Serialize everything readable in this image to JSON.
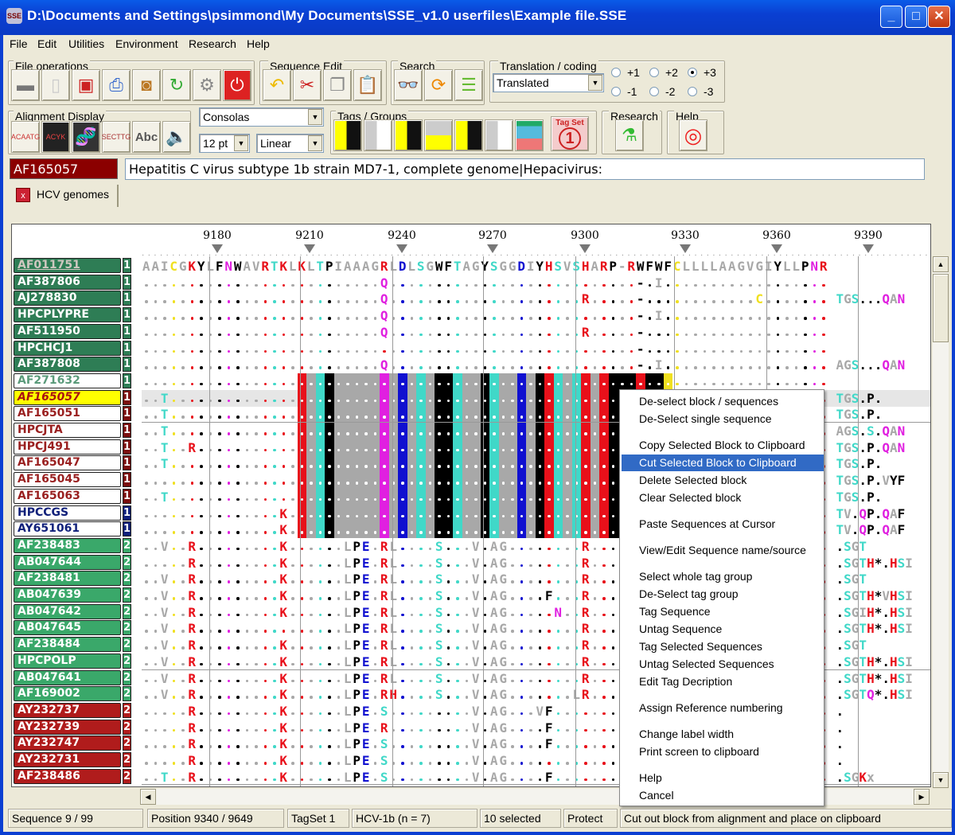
{
  "window": {
    "title": "D:\\Documents and Settings\\psimmond\\My Documents\\SSE_v1.0 userfiles\\Example file.SSE",
    "app_icon": "SSE",
    "controls": {
      "minimize": "_",
      "maximize": "□",
      "close": "✕"
    }
  },
  "menu": [
    "File",
    "Edit",
    "Utilities",
    "Environment",
    "Research",
    "Help"
  ],
  "toolbar": {
    "file_operations": {
      "label": "File operations",
      "buttons": [
        "open-folder",
        "new-document",
        "save",
        "print",
        "export-archive",
        "import",
        "settings-gear",
        "exit-power"
      ]
    },
    "sequence_edit": {
      "label": "Sequence Edit",
      "buttons": [
        "undo",
        "cut",
        "copy",
        "paste"
      ]
    },
    "search": {
      "label": "Search",
      "buttons": [
        "find-binoculars",
        "find-next",
        "search-list"
      ]
    },
    "translation": {
      "label": "Translation / coding",
      "mode": "Translated",
      "frames": [
        {
          "label": "+1",
          "selected": false
        },
        {
          "label": "+2",
          "selected": false
        },
        {
          "label": "+3",
          "selected": true
        },
        {
          "label": "-1",
          "selected": false
        },
        {
          "label": "-2",
          "selected": false
        },
        {
          "label": "-3",
          "selected": false
        }
      ]
    },
    "alignment_display": {
      "label": "Alignment Display",
      "font": "Consolas",
      "size": "12 pt",
      "layout": "Linear",
      "buttons": [
        "nucleotide-view",
        "colour-view",
        "dna-helix",
        "complement-view",
        "text-abc",
        "sound"
      ]
    },
    "tags_groups": {
      "label": "Tags / Groups",
      "buttons": [
        "tag-1",
        "tag-2",
        "tag-3",
        "tag-4",
        "tag-5",
        "tag-6",
        "tag-table"
      ],
      "tag_set_label": "Tag Set",
      "tag_set_number": "1"
    },
    "research": {
      "label": "Research"
    },
    "help": {
      "label": "Help"
    }
  },
  "current_sequence": {
    "accession": "AF165057",
    "description": "Hepatitis C virus subtype 1b strain MD7-1, complete genome|Hepacivirus:"
  },
  "tabs": [
    {
      "label": "HCV genomes",
      "close": "x"
    }
  ],
  "ruler": {
    "ticks": [
      "9180",
      "9210",
      "9240",
      "9270",
      "9300",
      "9330",
      "9360",
      "9390"
    ]
  },
  "colors": {
    "group1_green": "#2e7d55",
    "group2_green": "#3aa86a",
    "group_red": "#b01c1c",
    "group_darkred": "#7a0f0f",
    "group_navy": "#10207a",
    "highlight_yellow": "#ffff00",
    "menu_highlight": "#316ac5",
    "res_red": "#e8101a",
    "res_cyan": "#40d8c8",
    "res_magenta": "#e020e0",
    "res_blue": "#1010d0",
    "res_yellow": "#f0e020",
    "res_gray": "#a8a8a8",
    "res_black": "#000000"
  },
  "consensus": "AAICGKYLFNWAVRTKLKLTPIAAAGRLDLSGWFTAGYSGGDIYHSVSHARP-RWFWFCLLLLAAGVGIYLLPNR*RLG*TLRPL",
  "sequences": [
    {
      "name": "AF011751",
      "group": "1",
      "style": "g1u",
      "right": ""
    },
    {
      "name": "AF387806",
      "group": "1",
      "style": "g1",
      "right": ""
    },
    {
      "name": "AJ278830",
      "group": "1",
      "style": "g1",
      "right": "TGS...QAN"
    },
    {
      "name": "HPCPLYPRE",
      "group": "1",
      "style": "g1",
      "right": ""
    },
    {
      "name": "AF511950",
      "group": "1",
      "style": "g1",
      "right": ""
    },
    {
      "name": "HPCHCJ1",
      "group": "1",
      "style": "g1",
      "right": ""
    },
    {
      "name": "AF387808",
      "group": "1",
      "style": "g1",
      "right": "AGS...QAN"
    },
    {
      "name": "AF271632",
      "group": "1",
      "style": "w-green",
      "right": ""
    },
    {
      "name": "AF165057",
      "group": "1",
      "style": "yellow",
      "right": "TGS.P."
    },
    {
      "name": "AF165051",
      "group": "1",
      "style": "w-red",
      "right": "TGS.P."
    },
    {
      "name": "HPCJTA",
      "group": "1",
      "style": "w-red",
      "right": "AGS.S.QAN"
    },
    {
      "name": "HPCJ491",
      "group": "1",
      "style": "w-red",
      "right": "TGS.P.QAN"
    },
    {
      "name": "AF165047",
      "group": "1",
      "style": "w-red",
      "right": "TGS.P."
    },
    {
      "name": "AF165045",
      "group": "1",
      "style": "w-red",
      "right": "TGS.P.VYF"
    },
    {
      "name": "AF165063",
      "group": "1",
      "style": "w-red",
      "right": "TGS.P."
    },
    {
      "name": "HPCCGS",
      "group": "1",
      "style": "w-navy",
      "right": "TV.QP.QAF"
    },
    {
      "name": "AY651061",
      "group": "1",
      "style": "w-navy",
      "right": "TV.QP.QAF"
    },
    {
      "name": "AF238483",
      "group": "2",
      "style": "g2",
      "right": ".SGT"
    },
    {
      "name": "AB047644",
      "group": "2",
      "style": "g2",
      "right": ".SGTH*.HSI"
    },
    {
      "name": "AF238481",
      "group": "2",
      "style": "g2",
      "right": ".SGT"
    },
    {
      "name": "AB047639",
      "group": "2",
      "style": "g2",
      "right": ".SGTH*VHSI"
    },
    {
      "name": "AB047642",
      "group": "2",
      "style": "g2",
      "right": ".SGIH*.HSI"
    },
    {
      "name": "AB047645",
      "group": "2",
      "style": "g2",
      "right": ".SGTH*.HSI"
    },
    {
      "name": "AF238484",
      "group": "2",
      "style": "g2",
      "right": ".SGT"
    },
    {
      "name": "HPCPOLP",
      "group": "2",
      "style": "g2",
      "right": ".SGTH*.HSI"
    },
    {
      "name": "AB047641",
      "group": "2",
      "style": "g2",
      "right": ".SGTH*.HSI"
    },
    {
      "name": "AF169002",
      "group": "2",
      "style": "g2",
      "right": ".SGTQ*.HSI"
    },
    {
      "name": "AY232737",
      "group": "2",
      "style": "r2",
      "right": "."
    },
    {
      "name": "AY232739",
      "group": "2",
      "style": "r2",
      "right": "."
    },
    {
      "name": "AY232747",
      "group": "2",
      "style": "r2",
      "right": "."
    },
    {
      "name": "AY232731",
      "group": "2",
      "style": "r2",
      "right": "."
    },
    {
      "name": "AF238486",
      "group": "2",
      "style": "r2",
      "right": ".SGKx"
    }
  ],
  "context_menu": {
    "items": [
      {
        "label": "De-select block / sequences"
      },
      {
        "label": "De-Select single sequence",
        "sep_after": true
      },
      {
        "label": "Copy Selected Block to Clipboard"
      },
      {
        "label": "Cut Selected Block to Clipboard",
        "highlighted": true
      },
      {
        "label": "Delete Selected block"
      },
      {
        "label": "Clear Selected block",
        "sep_after": true
      },
      {
        "label": "Paste Sequences at Cursor",
        "sep_after": true
      },
      {
        "label": "View/Edit Sequence name/source",
        "sep_after": true
      },
      {
        "label": "Select whole tag group"
      },
      {
        "label": "De-Select tag group"
      },
      {
        "label": "Tag Sequence"
      },
      {
        "label": "Untag Sequence"
      },
      {
        "label": "Tag Selected Sequences"
      },
      {
        "label": "Untag Selected Sequences"
      },
      {
        "label": "Edit Tag Decription",
        "sep_after": true
      },
      {
        "label": "Assign Reference numbering",
        "sep_after": true
      },
      {
        "label": "Change label width"
      },
      {
        "label": "Print screen to clipboard",
        "sep_after": true
      },
      {
        "label": "Help"
      },
      {
        "label": "Cancel"
      }
    ]
  },
  "status": {
    "sequence": "Sequence 9 / 99",
    "position": "Position 9340 / 9649",
    "tagset": "TagSet 1",
    "group": "HCV-1b (n = 7)",
    "selected": "10 selected",
    "protect": "Protect",
    "hint": "Cut out block from alignment and place on clipboard"
  }
}
